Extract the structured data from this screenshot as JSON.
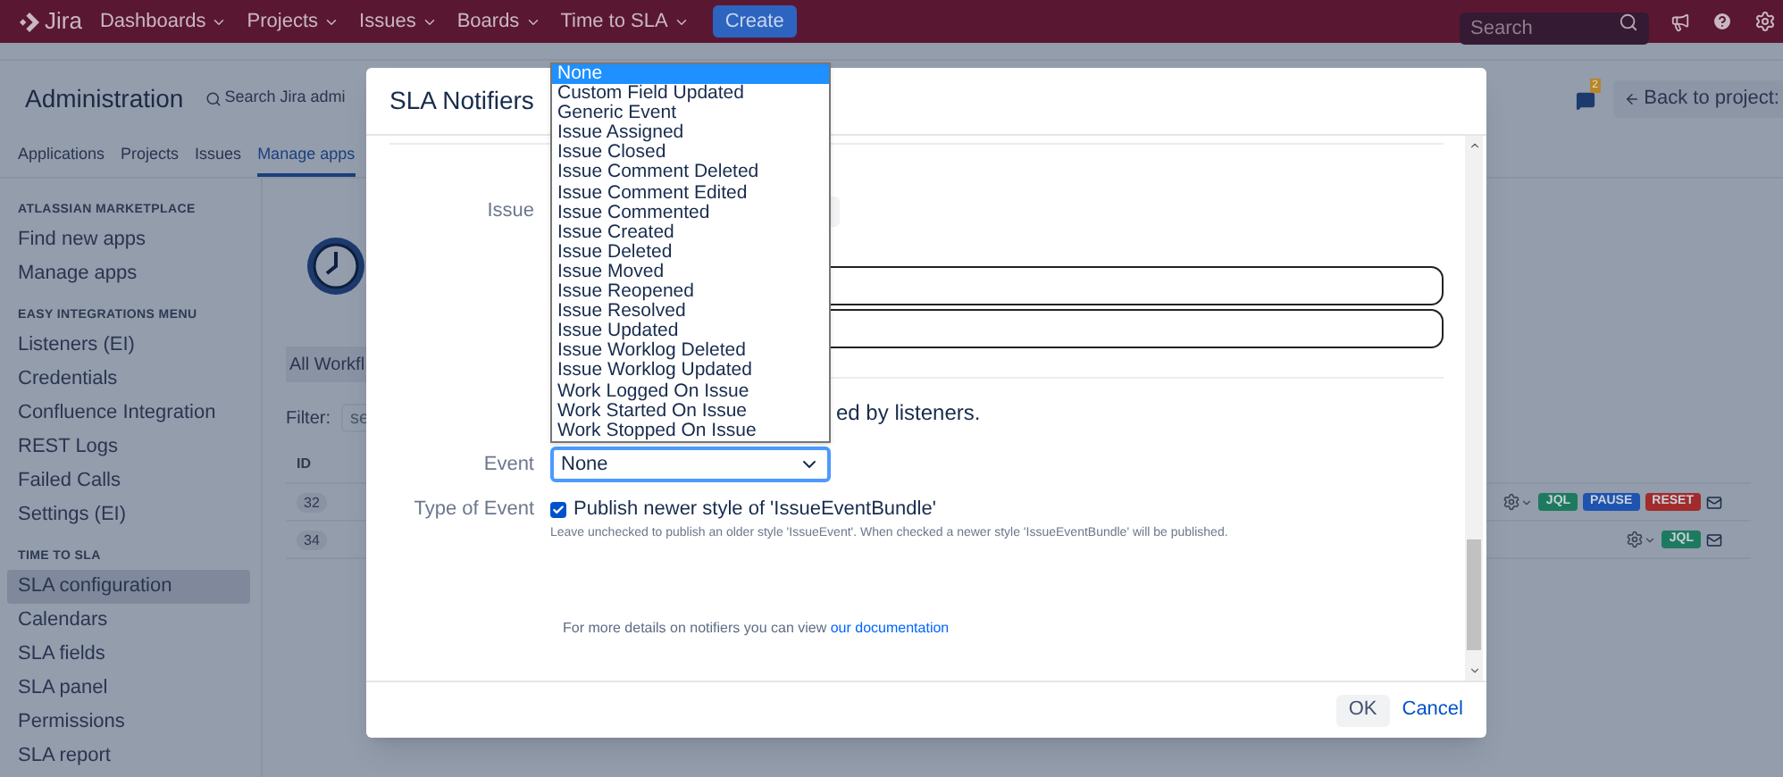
{
  "nav": {
    "logo": "Jira",
    "menus": [
      {
        "label": "Dashboards"
      },
      {
        "label": "Projects"
      },
      {
        "label": "Issues"
      },
      {
        "label": "Boards"
      },
      {
        "label": "Time to SLA"
      }
    ],
    "create": "Create",
    "search": {
      "placeholder": "Search"
    }
  },
  "header": {
    "title": "Administration",
    "search": "Search Jira admi",
    "notification_count": "2",
    "back": "Back to project:"
  },
  "tabs": [
    {
      "label": "Applications",
      "selected": false
    },
    {
      "label": "Projects",
      "selected": false
    },
    {
      "label": "Issues",
      "selected": false
    },
    {
      "label": "Manage apps",
      "selected": true
    }
  ],
  "sidebar": {
    "sections": [
      {
        "heading": "ATLASSIAN MARKETPLACE",
        "items": [
          {
            "label": "Find new apps",
            "selected": false
          },
          {
            "label": "Manage apps",
            "selected": false
          }
        ]
      },
      {
        "heading": "EASY INTEGRATIONS MENU",
        "items": [
          {
            "label": "Listeners (EI)",
            "selected": false
          },
          {
            "label": "Credentials",
            "selected": false
          },
          {
            "label": "Confluence Integration",
            "selected": false
          },
          {
            "label": "REST Logs",
            "selected": false
          },
          {
            "label": "Failed Calls",
            "selected": false
          },
          {
            "label": "Settings (EI)",
            "selected": false
          }
        ]
      },
      {
        "heading": "TIME TO SLA",
        "items": [
          {
            "label": "SLA configuration",
            "selected": true
          },
          {
            "label": "Calendars",
            "selected": false
          },
          {
            "label": "SLA fields",
            "selected": false
          },
          {
            "label": "SLA panel",
            "selected": false
          },
          {
            "label": "Permissions",
            "selected": false
          },
          {
            "label": "SLA report",
            "selected": false
          }
        ]
      }
    ]
  },
  "content": {
    "workflow_tab": "All Workfl",
    "filter": {
      "label": "Filter:",
      "placeholder": "se"
    },
    "table": {
      "columns": [
        "ID"
      ],
      "rows": [
        {
          "id": "32",
          "badges": [
            {
              "label": "JQL",
              "color": "#1e7a5e"
            },
            {
              "label": "PAUSE",
              "color": "#1f53b0"
            },
            {
              "label": "RESET",
              "color": "#a22b2b"
            }
          ]
        },
        {
          "id": "34",
          "badges": [
            {
              "label": "JQL",
              "color": "#1e7a5e"
            }
          ]
        }
      ]
    }
  },
  "dialog": {
    "title": "SLA Notifiers",
    "issue_label": "Issue",
    "note": "ed by listeners.",
    "event": {
      "label": "Event",
      "value": "None",
      "expanded": true,
      "options": [
        {
          "label": "None",
          "selected": true
        },
        {
          "label": "Custom Field Updated",
          "selected": false
        },
        {
          "label": "Generic Event",
          "selected": false
        },
        {
          "label": "Issue Assigned",
          "selected": false
        },
        {
          "label": "Issue Closed",
          "selected": false
        },
        {
          "label": "Issue Comment Deleted",
          "selected": false
        },
        {
          "label": "Issue Comment Edited",
          "selected": false
        },
        {
          "label": "Issue Commented",
          "selected": false
        },
        {
          "label": "Issue Created",
          "selected": false
        },
        {
          "label": "Issue Deleted",
          "selected": false
        },
        {
          "label": "Issue Moved",
          "selected": false
        },
        {
          "label": "Issue Reopened",
          "selected": false
        },
        {
          "label": "Issue Resolved",
          "selected": false
        },
        {
          "label": "Issue Updated",
          "selected": false
        },
        {
          "label": "Issue Worklog Deleted",
          "selected": false
        },
        {
          "label": "Issue Worklog Updated",
          "selected": false
        },
        {
          "label": "Work Logged On Issue",
          "selected": false
        },
        {
          "label": "Work Started On Issue",
          "selected": false
        },
        {
          "label": "Work Stopped On Issue",
          "selected": false
        }
      ]
    },
    "type_of_event": {
      "label": "Type of Event",
      "checkbox": "Publish newer style of 'IssueEventBundle'",
      "checked": true,
      "help": "Leave unchecked to publish an older style 'IssueEvent'. When checked a newer style 'IssueEventBundle' will be published."
    },
    "footer_text": "For more details on notifiers you can view",
    "footer_link": "our documentation",
    "buttons": {
      "ok": "OK",
      "cancel": "Cancel"
    }
  }
}
